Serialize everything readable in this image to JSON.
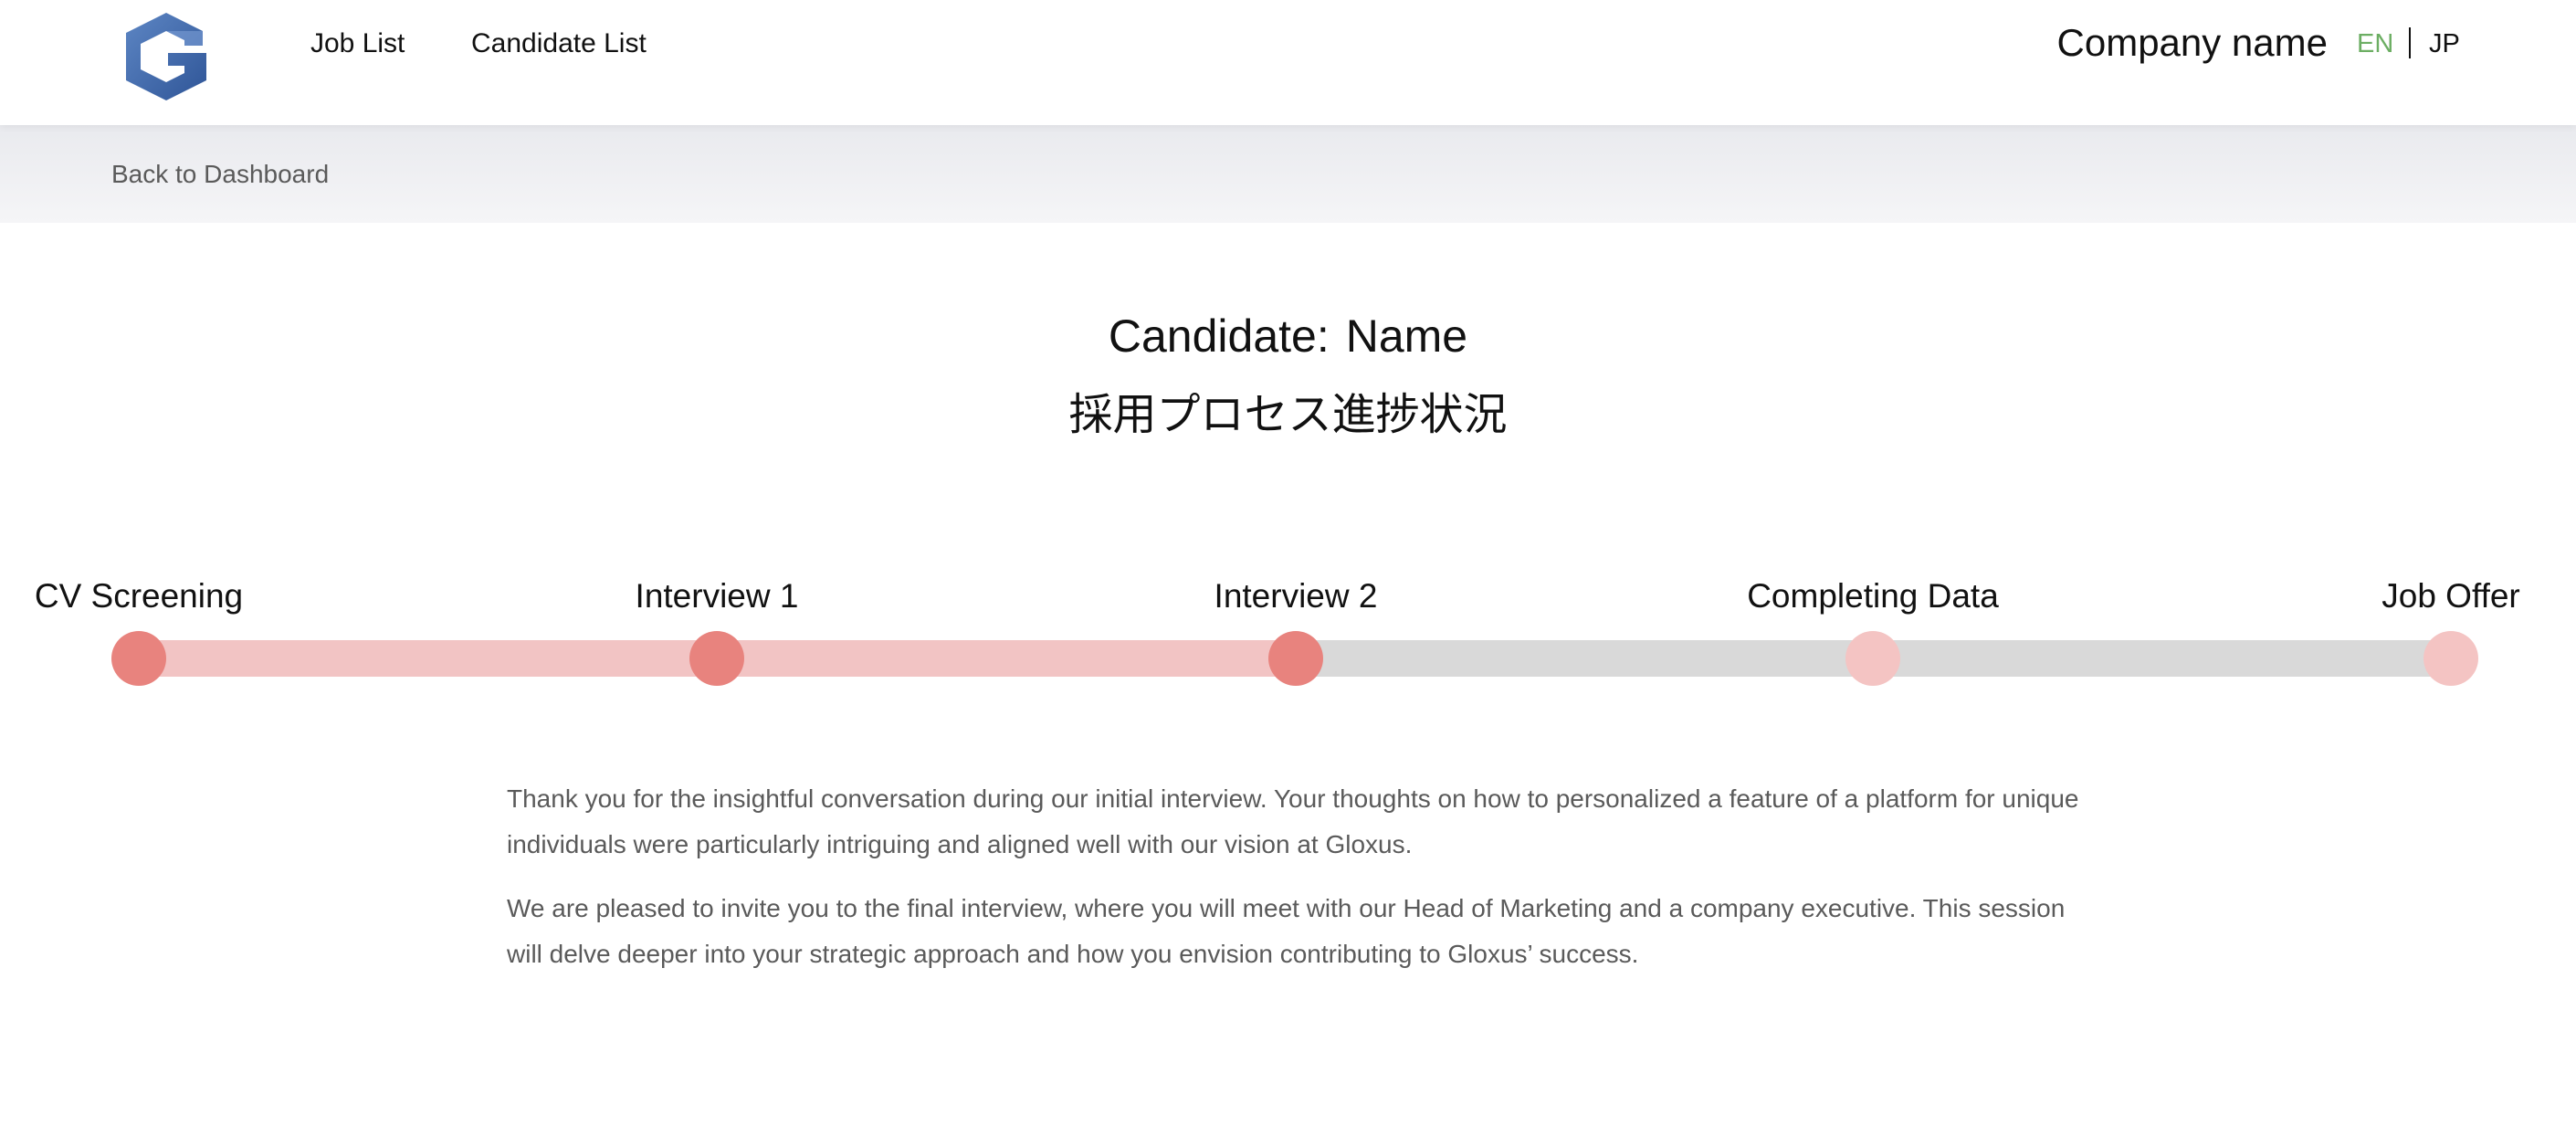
{
  "header": {
    "logo_icon": "gloxus-g-logo-icon",
    "nav": [
      {
        "label": "Job List"
      },
      {
        "label": "Candidate List"
      }
    ],
    "company_name": "Company name",
    "languages": {
      "en": "EN",
      "jp": "JP",
      "active": "EN"
    },
    "colors": {
      "active_language": "#6cae63"
    }
  },
  "breadcrumb": {
    "back_label": "Back to Dashboard"
  },
  "candidate": {
    "label": "Candidate:",
    "name": "Name",
    "process_title": "採用プロセス進捗状況"
  },
  "progress": {
    "stages": [
      {
        "label": "CV Screening",
        "status": "done"
      },
      {
        "label": "Interview 1",
        "status": "done"
      },
      {
        "label": "Interview 2",
        "status": "current"
      },
      {
        "label": "Completing Data",
        "status": "pending"
      },
      {
        "label": "Job Offer",
        "status": "pending"
      }
    ],
    "completed_stages": 3,
    "colors": {
      "done_dot": "#e8837e",
      "done_track": "#f2c4c4",
      "pending_dot": "#f4c4c3",
      "pending_track": "#d9d9d9"
    }
  },
  "message": {
    "paragraphs": [
      "Thank you for the insightful conversation during our initial interview. Your thoughts on how to personalized a feature of a platform for unique individuals were particularly intriguing and aligned well with our vision at Gloxus.",
      "We are pleased to invite you to the final interview, where you will meet with our Head of Marketing and a company executive. This session will delve deeper into your strategic approach and how you envision contributing to Gloxus’ success."
    ]
  }
}
